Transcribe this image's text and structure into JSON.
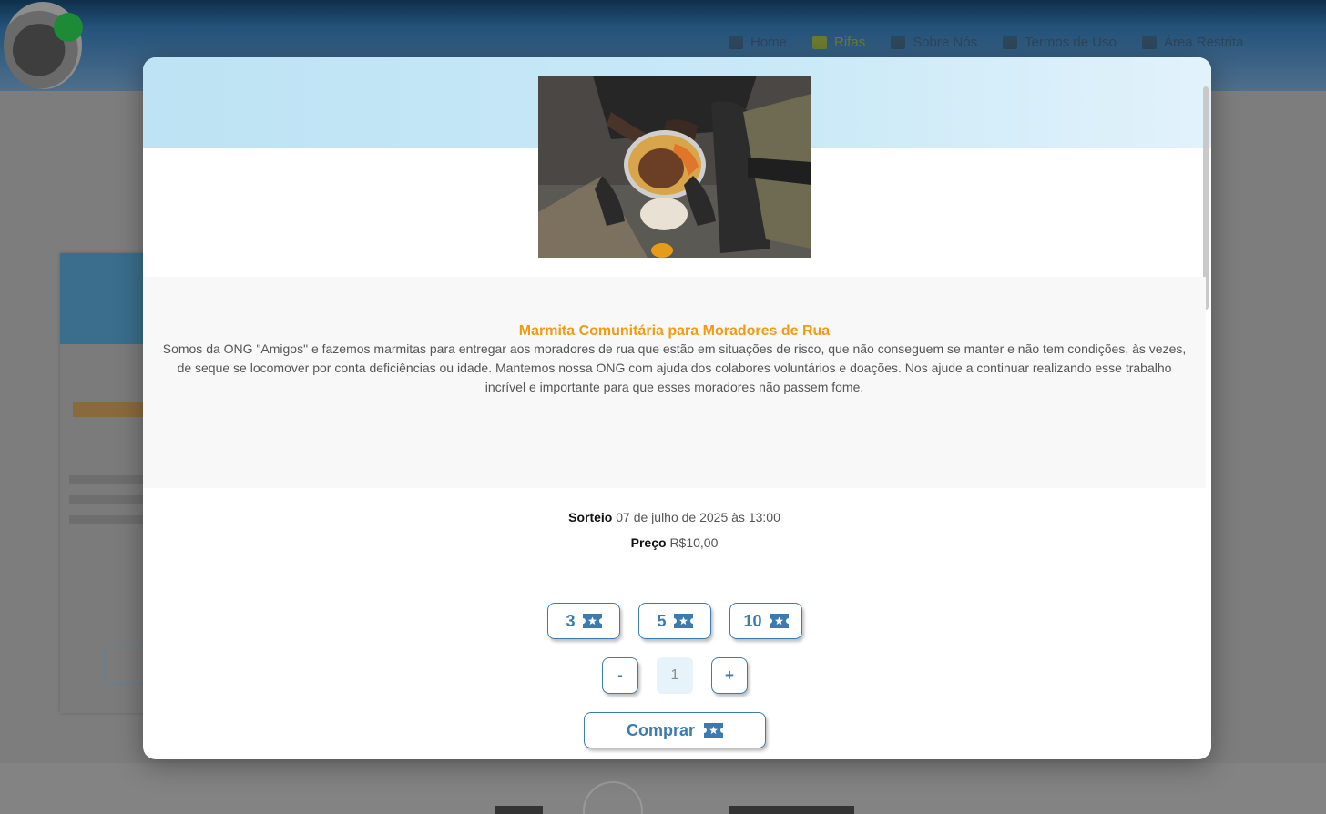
{
  "background": {
    "nav": [
      "Home",
      "Rifas",
      "Sobre Nós",
      "Termos de Uso",
      "Área Restrita"
    ]
  },
  "modal": {
    "image_alt": "Pessoa comendo marmita",
    "title": "Marmita Comunitária para Moradores de Rua",
    "description": "Somos da ONG \"Amigos\" e fazemos marmitas para entregar aos moradores de rua que estão em situações de risco, que não conseguem se manter e não tem condições, às vezes, de seque se locomover por conta deficiências ou idade. Mantemos nossa ONG com ajuda dos colabores voluntários e doações. Nos ajude a continuar realizando esse trabalho incrível e importante para que esses moradores não passem fome.",
    "draw_label": "Sorteio",
    "draw_date": "07 de julho de 2025 às 13:00",
    "price_label": "Preço",
    "price_value": "R$10,00",
    "packs": [
      "3",
      "5",
      "10"
    ],
    "decrement_label": "-",
    "quantity": "1",
    "increment_label": "+",
    "buy_label": "Comprar",
    "icons": {
      "ticket": "ticket-star-icon"
    },
    "colors": {
      "accent": "#3b7bb0",
      "title": "#f39a12",
      "band": "#bde3f4"
    }
  }
}
